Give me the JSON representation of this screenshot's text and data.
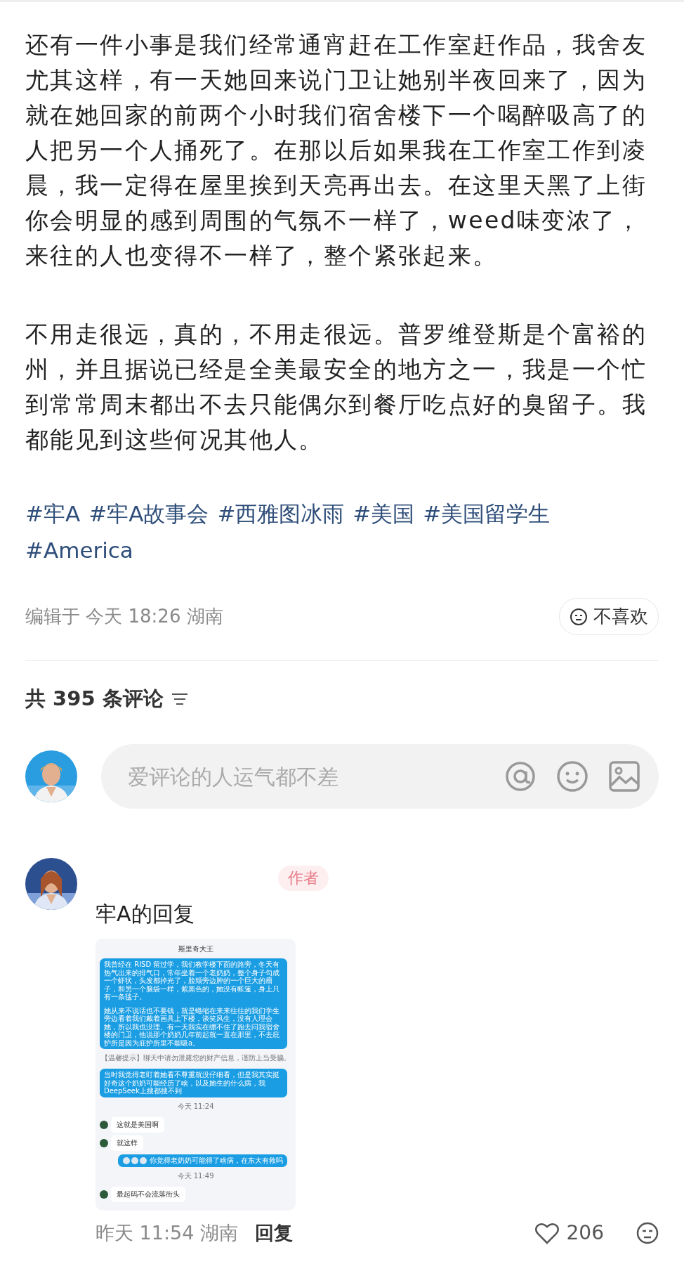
{
  "post": {
    "paragraphs": [
      "还有一件小事是我们经常通宵赶在工作室赶作品，我舍友尤其这样，有一天她回来说门卫让她别半夜回来了，因为就在她回家的前两个小时我们宿舍楼下一个喝醉吸高了的人把另一个人捅死了。在那以后如果我在工作室工作到凌晨，我一定得在屋里挨到天亮再出去。在这里天黑了上街你会明显的感到周围的气氛不一样了，weed味变浓了，来往的人也变得不一样了，整个紧张起来。",
      "不用走很远，真的，不用走很远。普罗维登斯是个富裕的州，并且据说已经是全美最安全的地方之一，我是一个忙到常常周末都出不去只能偶尔到餐厅吃点好的臭留子。我都能见到这些何况其他人。"
    ],
    "hashtags": [
      "#牢A",
      "#牢A故事会",
      "#西雅图冰雨",
      "#美国",
      "#美国留学生",
      "#America"
    ],
    "meta": "编辑于 今天 18:26 湖南",
    "dislike_button": "不喜欢"
  },
  "comments_header": {
    "count_label": "共 395 条评论"
  },
  "comment_input": {
    "placeholder": "爱评论的人运气都不差"
  },
  "comments": [
    {
      "badge": "作者",
      "text": "牢A的回复",
      "attachment": {
        "title": "斯里奇大王",
        "messages": [
          {
            "kind": "outgoing",
            "paragraphs": [
              "我曾经在 RISD 留过学，我们教学楼下面的路旁，冬天有热气出来的排气口，常年坐着一个老奶奶，整个身子勾成一个虾状，头发都掉光了，脸颊旁边肿的一个巨大的瘤子，和另一个脑袋一样，紫黑色的，她没有帐篷，身上只有一条毯子。",
              "她从来不说话也不要钱，就是蜷缩在来来往往的我们学生旁边看着我们戴着画具上下楼，谈笑风生，没有人理会她，所以我也没理。有一天我实在绷不住了跑去问我宿舍楼的门卫，他说那个奶奶几年前起就一直在那里，不去庇护所是因为庇护所里不能吸a。"
            ],
            "stickers": false
          },
          {
            "kind": "notice",
            "text": "【温馨提示】聊天中请勿泄露您的财产信息，谨防上当受骗。"
          },
          {
            "kind": "outgoing",
            "paragraphs": [
              "当时我觉得老盯着她看不尊重就没仔细看，但是我其实挺好奇这个奶奶可能经历了啥，以及她生的什么病，我DeepSeek上搜都搜不到"
            ],
            "stickers": false
          },
          {
            "kind": "time",
            "text": "今天 11:24"
          },
          {
            "kind": "incoming",
            "text": "这就是美国啊"
          },
          {
            "kind": "incoming",
            "text": "就这样"
          },
          {
            "kind": "outgoing",
            "paragraphs": [
              "你觉得老奶奶可能得了啥病，在东大有救吗"
            ],
            "stickers": true
          },
          {
            "kind": "time",
            "text": "今天 11:49"
          },
          {
            "kind": "incoming",
            "text": "最起码不会流落街头"
          }
        ]
      },
      "time": "昨天 11:54 湖南",
      "reply": "回复",
      "likes": "206"
    }
  ]
}
